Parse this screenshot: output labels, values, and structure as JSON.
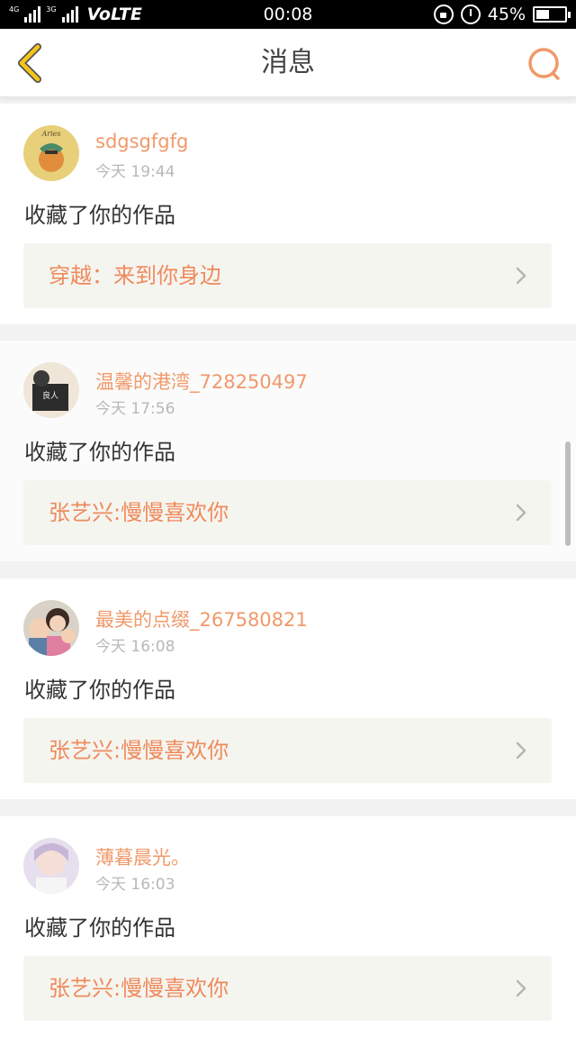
{
  "status_bar": {
    "network_small": "4G",
    "network_small2": "3G",
    "carrier": "VoLTE",
    "time": "00:08",
    "battery_percent": "45%",
    "battery_level": 0.45
  },
  "header": {
    "title": "消息",
    "back_icon": "chevron-left-icon",
    "search_icon": "search-icon"
  },
  "messages": [
    {
      "username": "sdgsgfgfg",
      "time": "今天 19:44",
      "action": "收藏了你的作品",
      "work_title": "穿越：来到你身边"
    },
    {
      "username": "温馨的港湾_728250497",
      "time": "今天 17:56",
      "action": "收藏了你的作品",
      "work_title": "张艺兴:慢慢喜欢你"
    },
    {
      "username": "最美的点缀_267580821",
      "time": "今天 16:08",
      "action": "收藏了你的作品",
      "work_title": "张艺兴:慢慢喜欢你"
    },
    {
      "username": "薄暮晨光。",
      "time": "今天 16:03",
      "action": "收藏了你的作品",
      "work_title": "张艺兴:慢慢喜欢你"
    }
  ],
  "colors": {
    "accent": "#f0996a",
    "back_arrow": "#f5c518",
    "card_bg": "#ffffff",
    "work_bg": "#f5f5f0"
  }
}
